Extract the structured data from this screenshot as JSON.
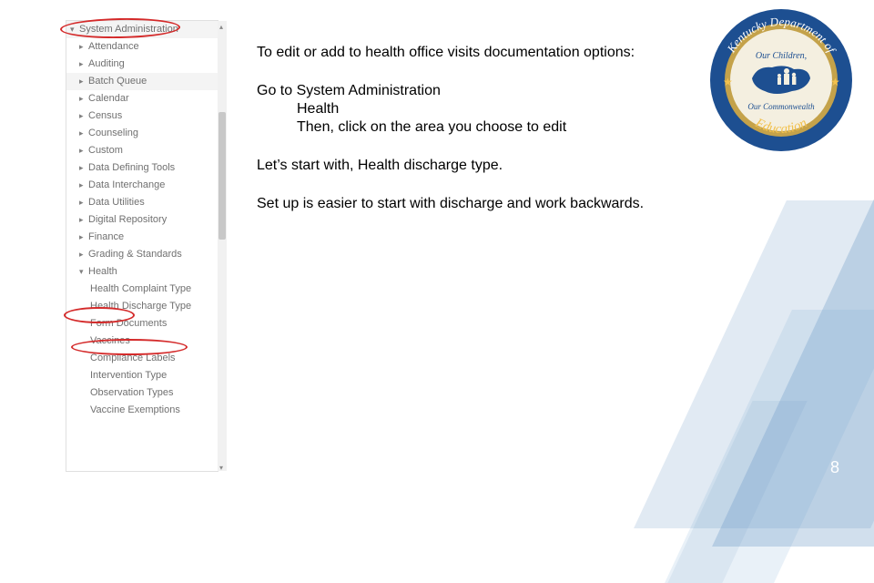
{
  "nav": {
    "root": "System Administration",
    "items": [
      "Attendance",
      "Auditing",
      "Batch Queue",
      "Calendar",
      "Census",
      "Counseling",
      "Custom",
      "Data Defining Tools",
      "Data Interchange",
      "Data Utilities",
      "Digital Repository",
      "Finance",
      "Grading & Standards"
    ],
    "health_label": "Health",
    "health_children": [
      "Health Complaint Type",
      "Health Discharge Type",
      "Form Documents",
      "Vaccines",
      "Compliance Labels",
      "Intervention Type",
      "Observation Types",
      "Vaccine Exemptions"
    ]
  },
  "text": {
    "intro": "To edit or add to health office visits documentation options:",
    "step1": "Go to System Administration",
    "step2": "Health",
    "step3": "Then, click on the area you choose to edit",
    "start": "Let’s start with, Health discharge type.",
    "tip": "Set up is easier to start with discharge and work backwards."
  },
  "seal": {
    "outer_top": "Kentucky Department of",
    "outer_bottom": "Education",
    "inner_top": "Our Children,",
    "inner_bottom": "Our Commonwealth"
  },
  "page_number": "8"
}
